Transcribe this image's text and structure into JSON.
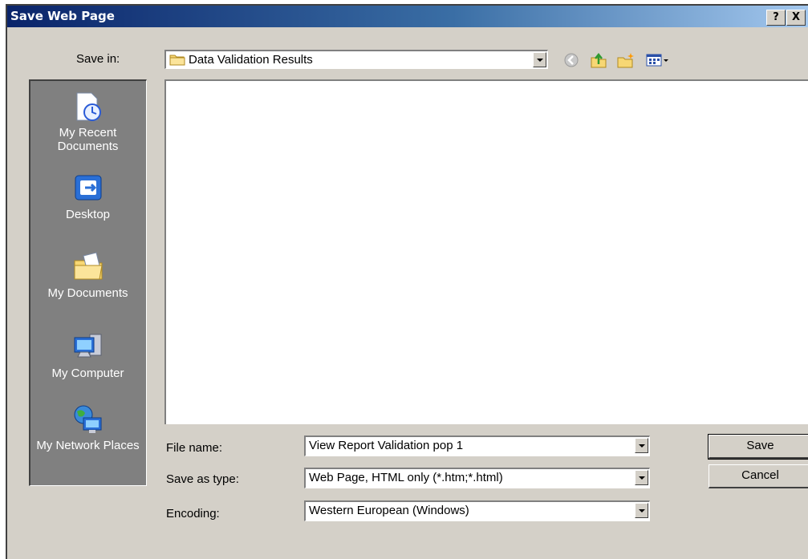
{
  "dialog": {
    "title": "Save Web Page",
    "help_label": "?",
    "close_label": "X"
  },
  "save_in": {
    "label": "Save in:",
    "value": "Data Validation Results",
    "icon": "folder-icon"
  },
  "toolbar": {
    "icons": [
      "back-icon",
      "up-folder-icon",
      "new-folder-icon",
      "views-menu-icon"
    ]
  },
  "places": [
    {
      "label": "My Recent Documents",
      "icon": "recent-documents-icon"
    },
    {
      "label": "Desktop",
      "icon": "desktop-icon"
    },
    {
      "label": "My Documents",
      "icon": "my-documents-icon"
    },
    {
      "label": "My Computer",
      "icon": "my-computer-icon"
    },
    {
      "label": "My Network Places",
      "icon": "network-places-icon"
    }
  ],
  "form": {
    "file_name": {
      "label": "File name:",
      "value": "View Report Validation pop 1"
    },
    "save_as_type": {
      "label": "Save as type:",
      "value": "Web Page, HTML only (*.htm;*.html)"
    },
    "encoding": {
      "label": "Encoding:",
      "value": "Western European (Windows)"
    }
  },
  "buttons": {
    "save": "Save",
    "cancel": "Cancel"
  },
  "colors": {
    "title_start": "#0a246a",
    "title_end": "#a6caf0",
    "dialog_bg": "#d4d0c8",
    "places_bg": "#808080"
  }
}
